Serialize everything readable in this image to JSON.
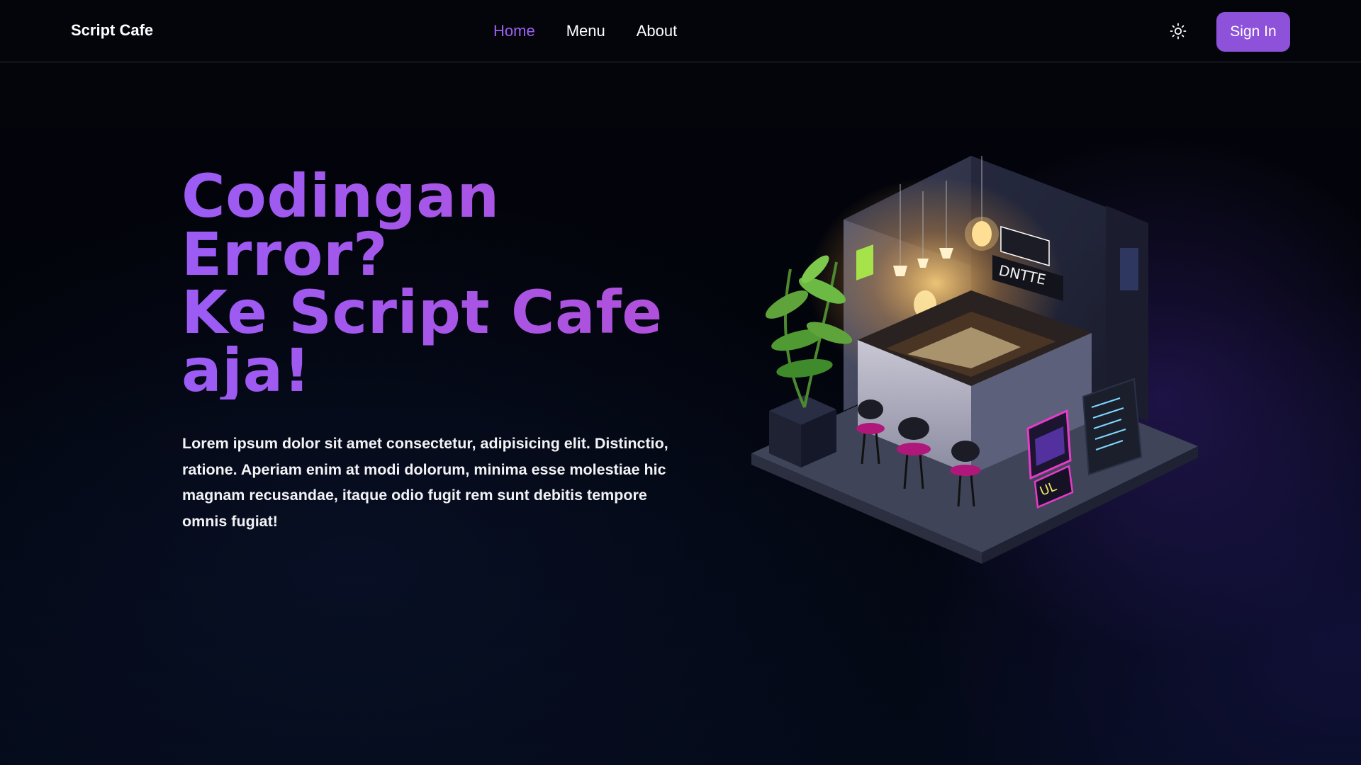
{
  "brand": "Script Cafe",
  "nav": {
    "items": [
      {
        "label": "Home",
        "active": true
      },
      {
        "label": "Menu",
        "active": false
      },
      {
        "label": "About",
        "active": false
      }
    ],
    "theme_icon": "sun-icon",
    "signin_label": "Sign In"
  },
  "hero": {
    "title_lines": [
      "Codingan",
      "Error?",
      "Ke Script Cafe",
      "aja!"
    ],
    "description": "Lorem ipsum dolor sit amet consectetur, adipisicing elit. Distinctio, ratione. Aperiam enim at modi dolorum, minima esse molestiae hic magnam recusandae, itaque odio fugit rem sunt debitis tempore omnis fugiat!",
    "image_subject": "isometric-cafe-illustration"
  },
  "colors": {
    "accent": "#9d61f1",
    "button": "#8e52da",
    "title_gradient_start": "#9b5cf5",
    "title_gradient_end": "#b34fd8",
    "background": "#020308"
  }
}
